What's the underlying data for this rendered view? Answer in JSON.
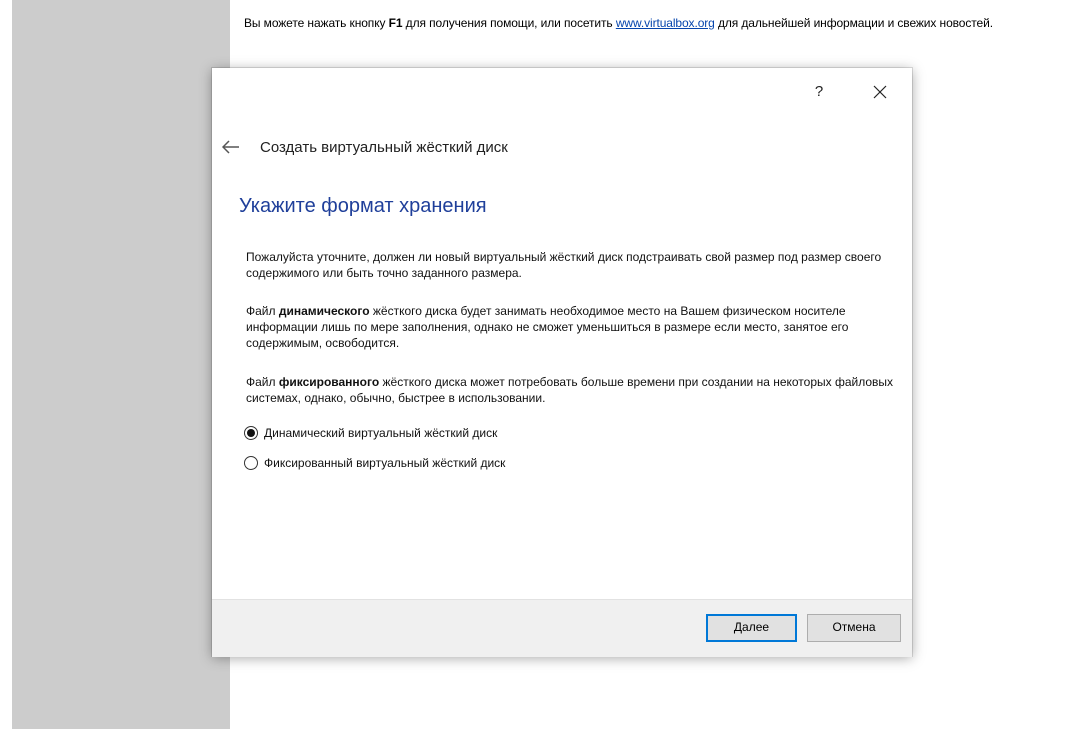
{
  "background_info": {
    "text_before_key": "Вы можете нажать кнопку ",
    "key": "F1",
    "text_mid": " для получения помощи, или посетить ",
    "link": "www.virtualbox.org",
    "text_after": " для дальнейшей информации и свежих новостей."
  },
  "dialog": {
    "help_label": "?",
    "wizard_title": "Создать виртуальный жёсткий диск",
    "heading": "Укажите формат хранения",
    "paragraph1": "Пожалуйста уточните, должен ли новый виртуальный жёсткий диск подстраивать свой размер под размер своего содержимого или быть точно заданного размера.",
    "paragraph2": {
      "prefix": "Файл ",
      "bold": "динамического",
      "suffix": " жёсткого диска будет занимать необходимое место на Вашем физическом носителе информации лишь по мере заполнения, однако не сможет уменьшиться в размере если место, занятое его содержимым, освободится."
    },
    "paragraph3": {
      "prefix": "Файл ",
      "bold": "фиксированного",
      "suffix": " жёсткого диска может потребовать больше времени при создании на некоторых файловых системах, однако, обычно, быстрее в использовании."
    },
    "options": [
      {
        "label": "Динамический виртуальный жёсткий диск",
        "checked": true
      },
      {
        "label": "Фиксированный виртуальный жёсткий диск",
        "checked": false
      }
    ],
    "buttons": {
      "next": "Далее",
      "cancel": "Отмена"
    }
  },
  "colors": {
    "heading": "#1f3f9a",
    "link": "#0645ad",
    "sidebar": "#cccccc",
    "footer": "#f0f0f0",
    "accent": "#0078d7"
  },
  "icons": {
    "back": "arrow-left-icon",
    "close": "close-icon"
  }
}
